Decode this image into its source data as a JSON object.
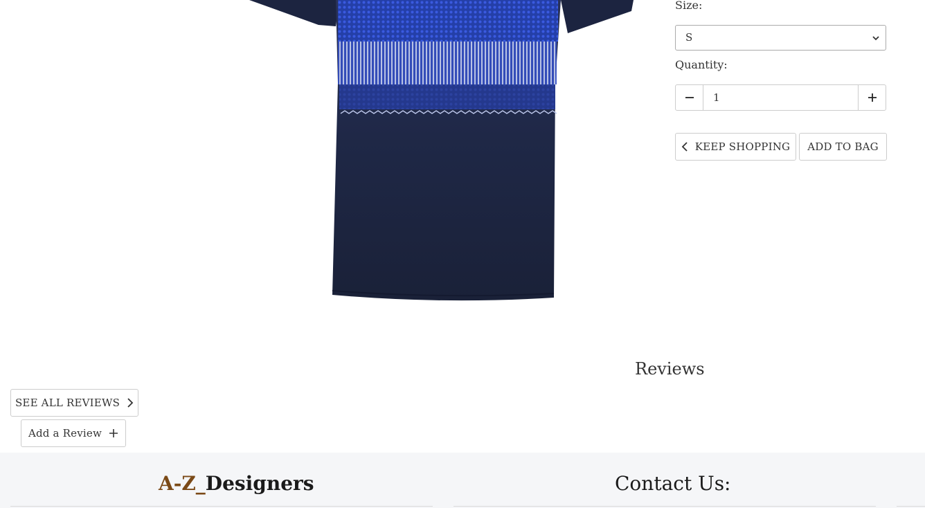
{
  "product": {
    "image_alt": "navy blue patterned t-shirt"
  },
  "options": {
    "size_label": "Size:",
    "size_selected": "S",
    "quantity_label": "Quantity:",
    "quantity_value": "1"
  },
  "actions": {
    "keep_shopping": "KEEP SHOPPING",
    "add_to_bag": "ADD TO BAG"
  },
  "reviews": {
    "title": "Reviews",
    "see_all": "SEE ALL REVIEWS",
    "add_review": "Add a Review"
  },
  "footer": {
    "brand_prefix": "A-Z_",
    "brand_name": "Designers",
    "contact_title": "Contact Us:"
  },
  "colors": {
    "brand_accent": "#7b4a17",
    "footer_bg": "#f5f6f8",
    "shirt_navy": "#1d2440",
    "shirt_blue": "#2f4fc9"
  },
  "icons": [
    "chevron-down-icon",
    "minus-icon",
    "plus-icon",
    "chevron-left-icon",
    "chevron-right-icon"
  ]
}
